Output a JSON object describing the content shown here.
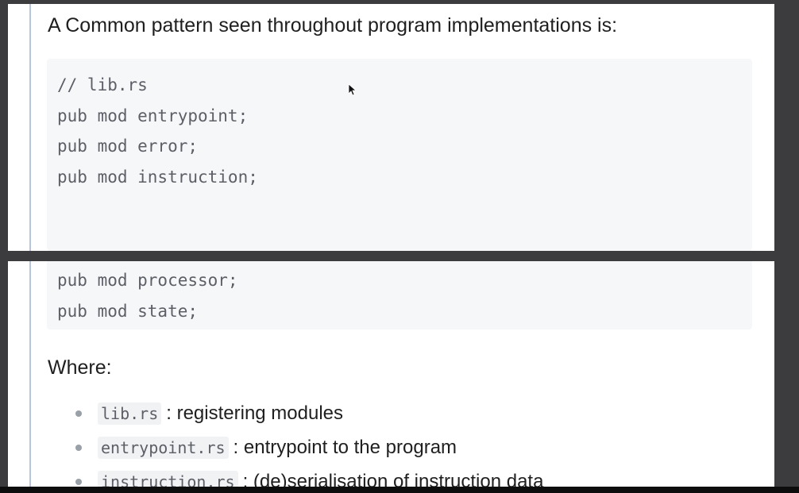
{
  "intro_text": "A Common pattern seen throughout program implementations is:",
  "code_top": {
    "lines": [
      "// lib.rs",
      "pub mod entrypoint;",
      "pub mod error;",
      "pub mod instruction;"
    ]
  },
  "code_bottom": {
    "lines": [
      "pub mod processor;",
      "pub mod state;"
    ]
  },
  "where_heading": "Where:",
  "bullets": [
    {
      "code": "lib.rs",
      "desc": ": registering modules"
    },
    {
      "code": "entrypoint.rs",
      "desc": ": entrypoint to the program"
    },
    {
      "code": "instruction.rs",
      "desc": ": (de)serialisation of instruction data"
    }
  ],
  "colors": {
    "background": "#3c3c3e",
    "page": "#ffffff",
    "code_bg": "#f6f7f9",
    "code_text": "#5c5f66",
    "rule": "#b7c4dc"
  },
  "icons": [
    "mouse-cursor-icon"
  ]
}
